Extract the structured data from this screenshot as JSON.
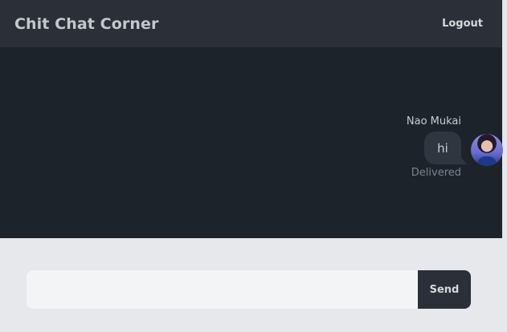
{
  "header": {
    "title": "Chit Chat Corner",
    "logout_label": "Logout"
  },
  "messages": [
    {
      "sender": "Nao Mukai",
      "text": "hi",
      "status": "Delivered"
    }
  ],
  "composer": {
    "input_value": "",
    "placeholder": "",
    "send_label": "Send"
  },
  "colors": {
    "navbar_bg": "#2b3038",
    "chat_bg": "#1d232a",
    "bubble_bg": "#2f3640",
    "composer_bg": "#e6e8eb"
  }
}
